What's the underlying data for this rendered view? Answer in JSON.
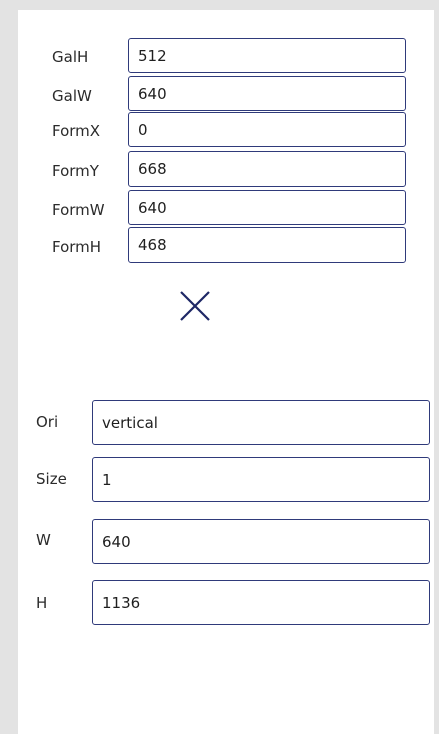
{
  "top_fields": [
    {
      "label": "GalH",
      "value": "512"
    },
    {
      "label": "GalW",
      "value": "640"
    },
    {
      "label": "FormX",
      "value": "0"
    },
    {
      "label": "FormY",
      "value": "668"
    },
    {
      "label": "FormW",
      "value": "640"
    },
    {
      "label": "FormH",
      "value": "468"
    }
  ],
  "close_icon": "close-icon",
  "bottom_fields": [
    {
      "label": "Ori",
      "value": "vertical"
    },
    {
      "label": "Size",
      "value": "1"
    },
    {
      "label": "W",
      "value": "640"
    },
    {
      "label": "H",
      "value": "1136"
    }
  ],
  "colors": {
    "background": "#e3e3e3",
    "panel": "#ffffff",
    "field_border": "#2f3a7a",
    "icon": "#1d2766"
  }
}
